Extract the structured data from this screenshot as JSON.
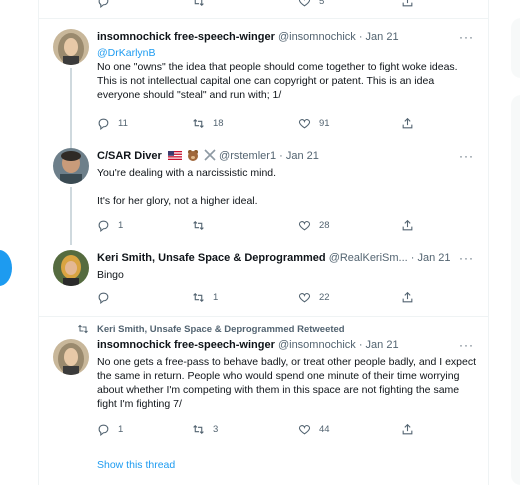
{
  "top_actions": {
    "reply": "",
    "retweet": "",
    "like": "5",
    "share": ""
  },
  "tweets": [
    {
      "name": "insomnochick free-speech-winger",
      "handle": "@insomnochick",
      "time": "· Jan 21",
      "mention": "@DrKarlynB",
      "text": "No one \"owns\" the idea that people should come together to fight woke ideas. This is not intellectual capital one can copyright or patent. This is an idea everyone should \"steal\" and run with; 1/",
      "replies": "11",
      "retweets": "18",
      "likes": "91"
    },
    {
      "name": "C/SAR Diver",
      "handle": "@rstemler1",
      "time": "· Jan 21",
      "text1": "You're dealing with a narcissistic mind.",
      "text2": "It's for her glory, not a higher ideal.",
      "replies": "1",
      "retweets": "",
      "likes": "28"
    },
    {
      "name": "Keri Smith, Unsafe Space & Deprogrammed",
      "handle": "@RealKeriSm...",
      "time": "· Jan 21",
      "text": "Bingo",
      "replies": "",
      "retweets": "1",
      "likes": "22"
    },
    {
      "retweeted_by": "Keri Smith, Unsafe Space & Deprogrammed Retweeted",
      "name": "insomnochick free-speech-winger",
      "handle": "@insomnochick",
      "time": "· Jan 21",
      "text": "No one gets a free-pass to behave badly, or treat other people badly, and I expect the same in return. People who would spend one minute of their time worrying about whether I'm competing with them in this space are not fighting the same fight I'm fighting 7/",
      "replies": "1",
      "retweets": "3",
      "likes": "44",
      "show_thread": "Show this thread"
    }
  ],
  "more_glyph": "···",
  "colors": {
    "accent": "#1d9bf0",
    "muted": "#536471",
    "border": "#eff3f4",
    "text": "#0f1419"
  }
}
